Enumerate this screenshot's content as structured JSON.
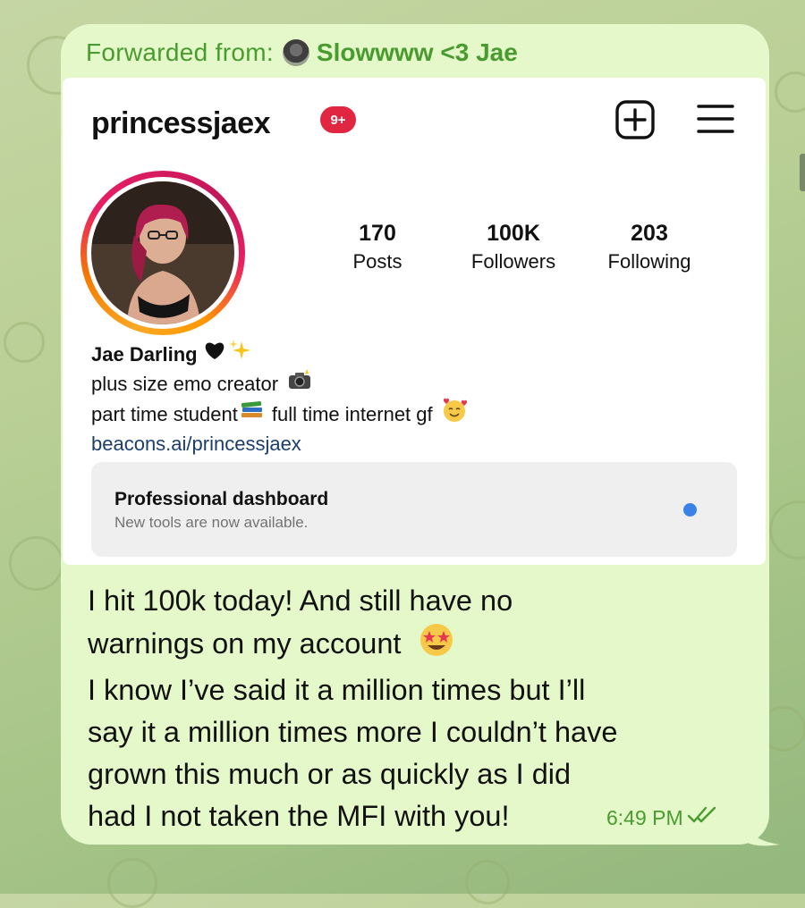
{
  "forwarded": {
    "label": "Forwarded from:",
    "sender_name": "Slowwww <3 Jae"
  },
  "profile": {
    "username": "princessjaex",
    "notification_badge": "9+",
    "stats": [
      {
        "value": "170",
        "label": "Posts"
      },
      {
        "value": "100K",
        "label": "Followers"
      },
      {
        "value": "203",
        "label": "Following"
      }
    ],
    "bio": {
      "name": "Jae Darling",
      "line1": "plus size emo creator",
      "line2_a": "part time student",
      "line2_b": "full time internet gf",
      "link": "beacons.ai/princessjaex"
    },
    "dashboard": {
      "title": "Professional dashboard",
      "subtitle": "New tools are now available."
    }
  },
  "message": {
    "lines": [
      "I hit 100k today! And still have no",
      "warnings on my account",
      "I know I’ve said it a million times but I’ll",
      "say it a million times more I couldn’t have",
      "grown this much or as quickly as I did",
      "had I not taken the MFI with you!"
    ],
    "time": "6:49 PM"
  },
  "colors": {
    "bubble": "#e4f8c9",
    "accent_green": "#4a9b2f",
    "badge_red": "#e02640",
    "link_blue": "#1b3e6e",
    "dot_blue": "#3a82e8"
  },
  "icons": [
    "black-heart-icon",
    "sparkles-icon",
    "camera-flash-icon",
    "books-icon",
    "smiling-face-hearts-icon",
    "star-struck-icon",
    "double-check-icon",
    "plus-square-icon",
    "hamburger-menu-icon"
  ]
}
